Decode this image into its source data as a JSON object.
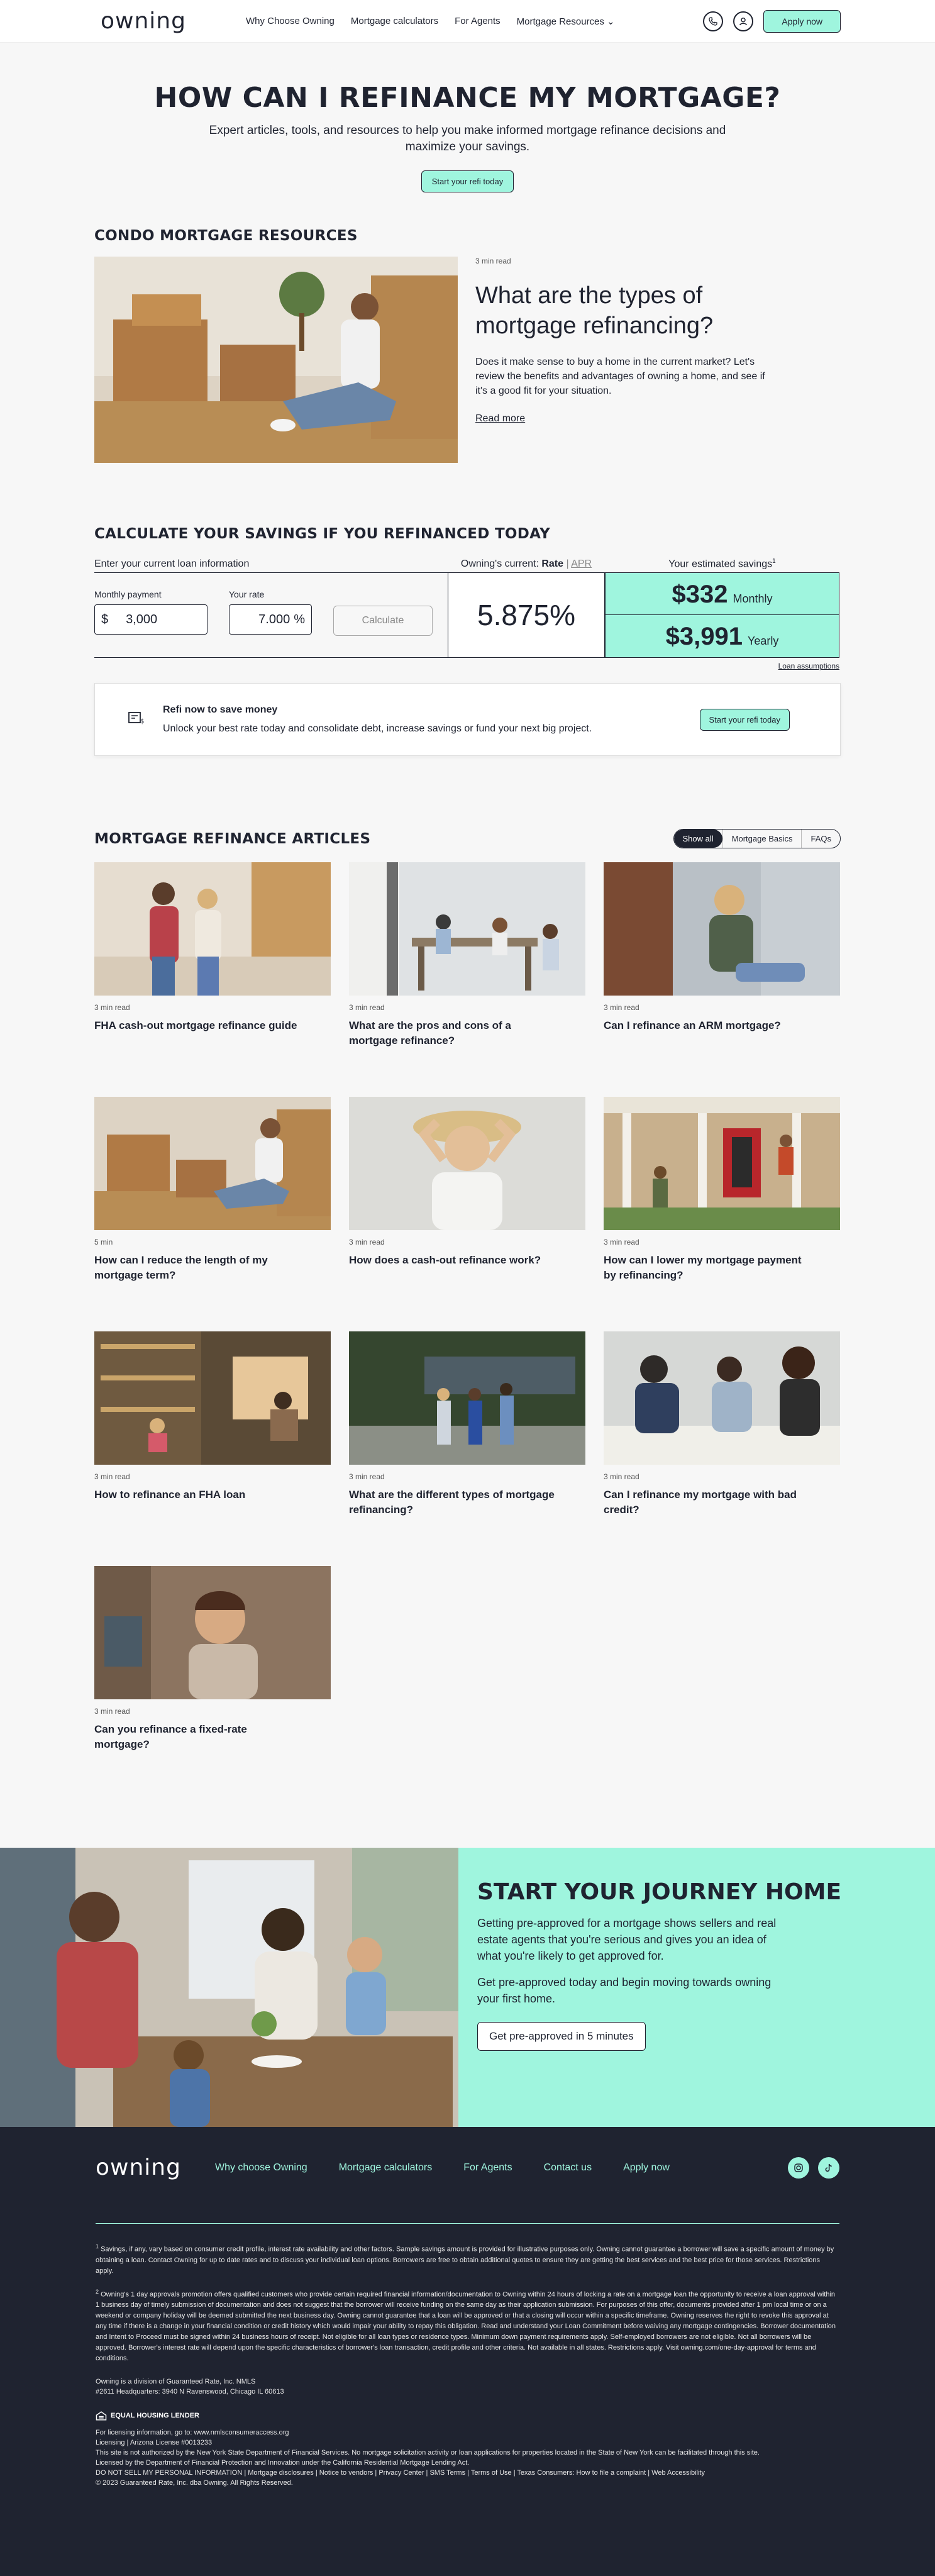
{
  "header": {
    "logo": "owning",
    "nav": [
      "Why Choose Owning",
      "Mortgage calculators",
      "For Agents",
      "Mortgage Resources ⌄"
    ],
    "apply_label": "Apply now",
    "colors": {
      "accent": "#9ff5de",
      "dark": "#1f2330"
    }
  },
  "hero": {
    "title": "HOW CAN I REFINANCE MY MORTGAGE?",
    "subtitle": "Expert articles, tools, and resources to help you make informed mortgage refinance decisions and maximize your savings.",
    "cta": "Start your refi today"
  },
  "condo": {
    "section_title": "CONDO MORTGAGE RESOURCES",
    "meta": "3 min read",
    "title": "What are the types of mortgage refinancing?",
    "body": "Does it make sense to buy a home in the current market? Let's review the benefits and advantages of owning a home, and see if it's a good fit for your situation.",
    "link": "Read more"
  },
  "calc": {
    "section_title": "CALCULATE YOUR SAVINGS IF YOU REFINANCED TODAY",
    "enter_label": "Enter your current loan information",
    "owning_label": "Owning's current:",
    "rate_label": "Rate",
    "sep": "|",
    "apr_label": "APR",
    "savings_label": "Your estimated savings",
    "savings_sup": "1",
    "monthly_payment_label": "Monthly payment",
    "monthly_payment_prefix": "$",
    "monthly_payment_value": "3,000",
    "your_rate_label": "Your rate",
    "your_rate_value": "7.000",
    "your_rate_suffix": "%",
    "calculate_label": "Calculate",
    "owning_rate": "5.875%",
    "monthly_savings": "$332",
    "monthly_savings_label": "Monthly",
    "yearly_savings": "$3,991",
    "yearly_savings_label": "Yearly",
    "assumptions": "Loan assumptions"
  },
  "refi_card": {
    "title": "Refi now to save money",
    "desc": "Unlock your best rate today and consolidate debt, increase savings or fund your next big project.",
    "cta": "Start your refi today"
  },
  "articles": {
    "section_title": "MORTGAGE REFINANCE ARTICLES",
    "filters": [
      "Show all",
      "Mortgage Basics",
      "FAQs"
    ],
    "items": [
      {
        "meta": "3 min read",
        "title": "FHA cash-out mortgage refinance guide"
      },
      {
        "meta": "3 min read",
        "title": "What are the pros and cons of a mortgage refinance?"
      },
      {
        "meta": "3 min read",
        "title": "Can I refinance an ARM mortgage?"
      },
      {
        "meta": "5 min",
        "title": "How can I reduce the length of my mortgage term?"
      },
      {
        "meta": "3 min read",
        "title": "How does a cash-out refinance work?"
      },
      {
        "meta": "3 min read",
        "title": "How can I lower my mortgage payment by refinancing?"
      },
      {
        "meta": "3 min read",
        "title": "How to refinance an FHA loan"
      },
      {
        "meta": "3 min read",
        "title": "What are the different types of mortgage refinancing?"
      },
      {
        "meta": "3 min read",
        "title": "Can I refinance my mortgage with bad credit?"
      },
      {
        "meta": "3 min read",
        "title": "Can you refinance a fixed-rate mortgage?"
      }
    ]
  },
  "journey": {
    "title": "START YOUR JOURNEY HOME",
    "p1": "Getting pre-approved for a mortgage shows sellers and real estate agents that you're serious and gives you an idea of what you're likely to get approved for.",
    "p2": "Get pre-approved today and begin moving towards owning your first home.",
    "cta": "Get pre-approved in 5 minutes"
  },
  "footer": {
    "logo": "owning",
    "nav": [
      "Why choose Owning",
      "Mortgage calculators",
      "For Agents",
      "Contact us",
      "Apply now"
    ],
    "disc1_num": "1",
    "disc1": "Savings, if any, vary based on consumer credit profile, interest rate availability and other factors. Sample savings amount is provided for illustrative purposes only. Owning cannot guarantee a borrower will save a specific amount of money by obtaining a loan. Contact Owning for up to date rates and to discuss your individual loan options. Borrowers are free to obtain additional quotes to ensure they are getting the best services and the best price for those services. Restrictions apply.",
    "disc2_num": "2",
    "disc2": "Owning's 1 day approvals promotion offers qualified customers who provide certain required financial information/documentation to Owning within 24 hours of locking a rate on a mortgage loan the opportunity to receive a loan approval within 1 business day of timely submission of documentation and does not suggest that the borrower will receive funding on the same day as their application submission. For purposes of this offer, documents provided after 1 pm local time or on a weekend or company holiday will be deemed submitted the next business day.  Owning cannot guarantee that a loan will be approved or that a closing will occur within a specific timeframe.  Owning reserves the right to revoke this approval at any time if there is a change in your financial condition or credit history which would impair your ability to repay this obligation. Read and understand your Loan Commitment before waiving any mortgage contingencies. Borrower documentation and Intent to Proceed must be signed within 24 business hours of receipt. Not eligible for all loan types or residence types. Minimum down payment requirements apply. Self-employed borrowers are not eligible. Not all borrowers will be approved. Borrower's interest rate will depend upon the specific characteristics of borrower's loan transaction, credit profile and other criteria. Not available in all states. Restrictions apply. Visit owning.com/one-day-approval for terms and conditions.",
    "company1": "Owning is a division of Guaranteed Rate, Inc. NMLS",
    "company2": "#2611 Headquarters: 3940 N Ravenswood, Chicago IL 60613",
    "ehl": "EQUAL HOUSING LENDER",
    "lic1": "For licensing information, go to: www.nmlsconsumeraccess.org",
    "lic2": "Licensing | Arizona License #0013233",
    "lic3": "This site is not authorized by the New York State Department of Financial Services. No mortgage solicitation activity or loan applications for properties located in the State of New York can be facilitated through this site.",
    "lic4": "Licensed by the Department of Financial Protection and Innovation under the California Residential Mortgage Lending Act.",
    "lic5": "DO NOT SELL MY PERSONAL INFORMATION | Mortgage disclosures | Notice to vendors | Privacy Center | SMS Terms | Terms of Use | Texas Consumers: How to file a complaint | Web Accessibility",
    "copyright": "© 2023 Guaranteed Rate, Inc. dba Owning. All Rights Reserved."
  }
}
